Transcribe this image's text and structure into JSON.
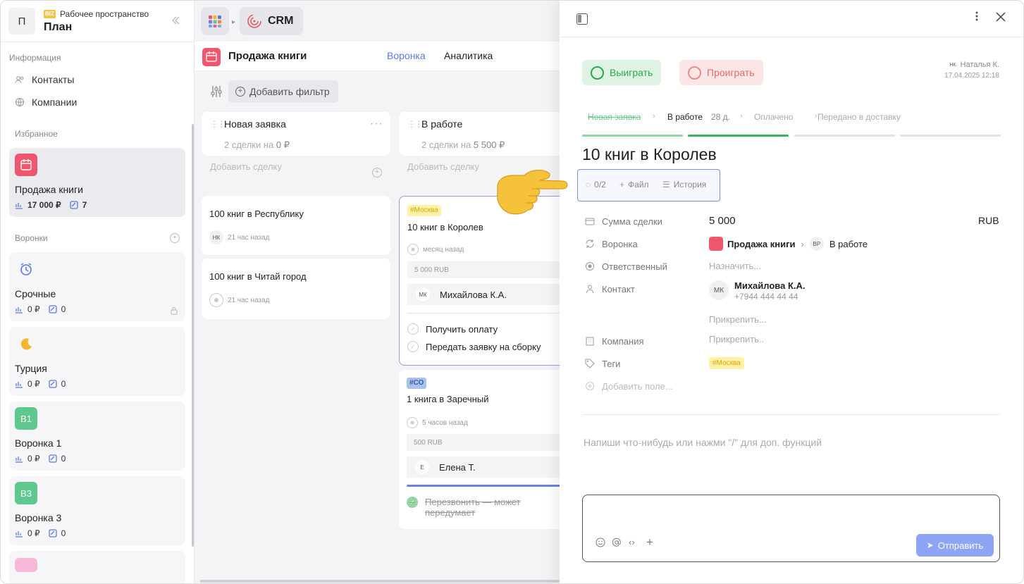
{
  "sidebar": {
    "workspace_badge": "BIZ",
    "workspace_sub": "Рабочее пространство",
    "workspace_title": "План",
    "workspace_initial": "П",
    "section_info": "Информация",
    "info_items": [
      {
        "label": "Контакты",
        "icon": "contacts-icon"
      },
      {
        "label": "Компании",
        "icon": "companies-icon"
      }
    ],
    "section_favorites": "Избранное",
    "favorite": {
      "name": "Продажа книги",
      "amount": "17 000 ₽",
      "count": "7",
      "color": "#f0576f"
    },
    "section_pipelines": "Воронки",
    "pipelines": [
      {
        "name": "Срочные",
        "amount": "0 ₽",
        "count": "0",
        "icon": "alarm-clock-icon",
        "locked": true
      },
      {
        "name": "Турция",
        "amount": "0 ₽",
        "count": "0",
        "icon": "crescent-moon-icon"
      },
      {
        "name": "Воронка 1",
        "amount": "0 ₽",
        "count": "0",
        "badge": "В1",
        "color": "#5ec98f"
      },
      {
        "name": "Воронка 3",
        "amount": "0 ₽",
        "count": "0",
        "badge": "В3",
        "color": "#5ec98f"
      }
    ]
  },
  "topbar": {
    "crm_label": "CRM"
  },
  "pipeline_bar": {
    "name": "Продажа книги",
    "tab_funnel": "Воронка",
    "tab_analytics": "Аналитика"
  },
  "filter": {
    "add_label": "Добавить фильтр"
  },
  "columns": [
    {
      "title": "Новая заявка",
      "sub_prefix": "2 сделки на",
      "sub_amount": "0 ₽",
      "add": "Добавить сделку",
      "deals": [
        {
          "title": "100 книг в Республику",
          "avatar": "НК",
          "time": "21 час назад"
        },
        {
          "title": "100 книг в Читай город",
          "time": "21 час назад"
        }
      ]
    },
    {
      "title": "В работе",
      "sub_prefix": "2 сделки на",
      "sub_amount": "5 500 ₽",
      "add": "Добавить сделку",
      "deals": [
        {
          "tag": "#Москва",
          "title": "10 книг в Королев",
          "time": "месяц назад",
          "amount": "5 000 RUB",
          "assignee_av": "МК",
          "assignee": "Михайлова К.А.",
          "tasks": [
            "Получить оплату",
            "Передать заявку на сборку"
          ]
        },
        {
          "tag": "#СО",
          "title": "1 книга в Заречный",
          "time": "5 часов назад",
          "amount": "500 RUB",
          "assignee_av": "Е",
          "assignee": "Елена Т.",
          "tasks_done": [
            "Перезвонить — может передумает"
          ]
        }
      ]
    }
  ],
  "pane": {
    "win_label": "Выиграть",
    "lose_label": "Проиграть",
    "creator_av": "НК",
    "creator_name": "Наталья К.",
    "created_at": "17.04.2025 12:18",
    "stages": [
      {
        "label": "Новая заявка",
        "state": "done"
      },
      {
        "label": "В работе",
        "state": "current",
        "duration": "28 д."
      },
      {
        "label": "Оплачено",
        "state": "todo"
      },
      {
        "label": "Передано в доставку",
        "state": "todo"
      }
    ],
    "title": "10 книг в Королев",
    "actions": {
      "checklist": "0/2",
      "file": "Файл",
      "history": "История"
    },
    "fields": {
      "sum_label": "Сумма сделки",
      "sum_value": "5 000",
      "currency": "RUB",
      "funnel_label": "Воронка",
      "funnel_value": "Продажа книги",
      "stage_av": "ВР",
      "stage_value": "В работе",
      "owner_label": "Ответственный",
      "owner_value": "Назначить...",
      "contact_label": "Контакт",
      "contact_av": "МК",
      "contact_name": "Михайлова К.А.",
      "contact_phone": "+7944 444 44 44",
      "contact_attach": "Прикрепить...",
      "company_label": "Компания",
      "company_value": "Прикрепить..",
      "tags_label": "Теги",
      "tag_value": "#Москва",
      "add_field": "Добавить поле..."
    },
    "comment_hint": "Напиши что-нибудь или нажми \"/\" для доп. функций",
    "send_label": "Отправить"
  },
  "colors": {
    "accent": "#5b7bde",
    "win": "#2aa84a",
    "lose": "#e46a6a",
    "brand_pink": "#f0576f"
  }
}
